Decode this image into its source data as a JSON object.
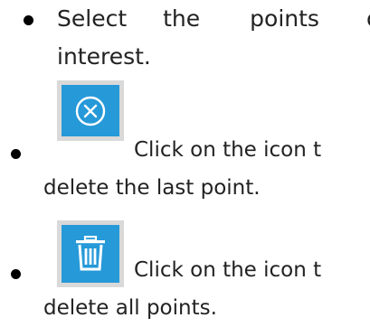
{
  "items": [
    {
      "line1_words": [
        "Select",
        "the",
        "points",
        "o"
      ],
      "line2": "interest."
    },
    {
      "icon": "cancel-circle-icon",
      "line1": "Click on the icon t",
      "line2": "delete the last point."
    },
    {
      "icon": "trash-icon",
      "line1": "Click on the icon t",
      "line2": "delete all points."
    }
  ],
  "colors": {
    "icon_blue": "#2699d8",
    "icon_frame": "#d9d9d9",
    "text": "#222222"
  }
}
